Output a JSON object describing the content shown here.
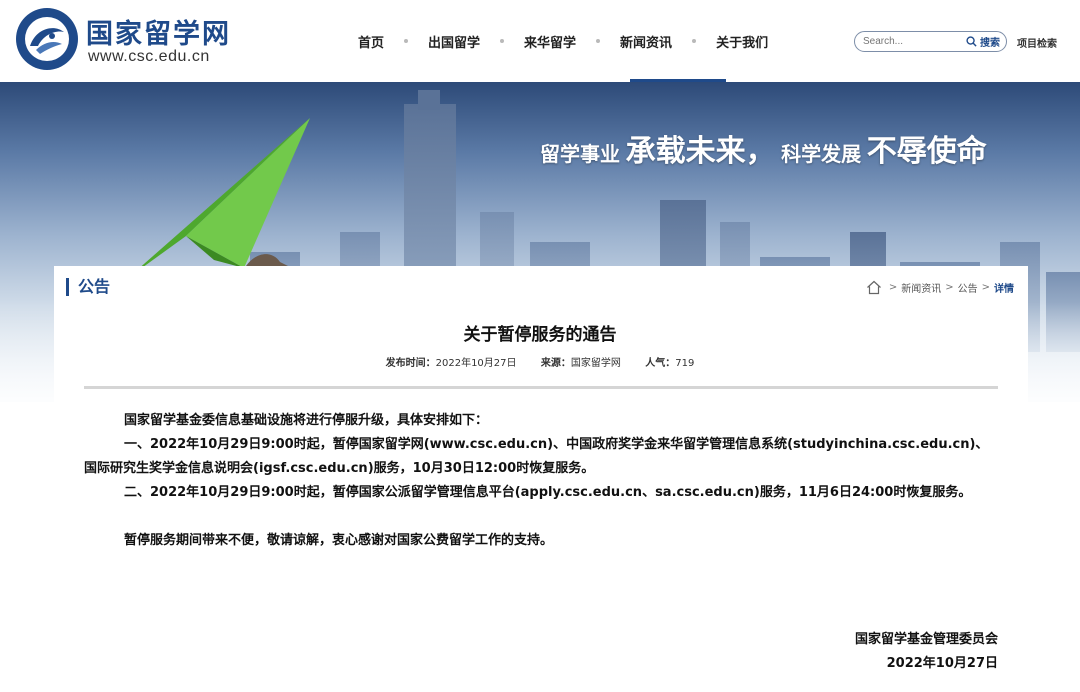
{
  "header": {
    "logo_title": "国家留学网",
    "logo_url": "www.csc.edu.cn",
    "nav": [
      {
        "label": "首页"
      },
      {
        "label": "出国留学"
      },
      {
        "label": "来华留学"
      },
      {
        "label": "新闻资讯"
      },
      {
        "label": "关于我们"
      }
    ],
    "active_nav": "新闻资讯",
    "search": {
      "placeholder": "Search...",
      "button": "搜索"
    },
    "project_search": "项目检索"
  },
  "banner": {
    "slogan_part1": "留学事业",
    "slogan_part2": "承载未来，",
    "slogan_part3": "科学发展",
    "slogan_part4": "不辱使命"
  },
  "section": {
    "label": "公告"
  },
  "breadcrumb": {
    "items": [
      "新闻资讯",
      "公告"
    ],
    "current": "详情",
    "separator": ">"
  },
  "article": {
    "title": "关于暂停服务的通告",
    "meta": {
      "date_label": "发布时间：",
      "date": "2022年10月27日",
      "source_label": "来源：",
      "source": "国家留学网",
      "views_label": "人气：",
      "views": "719"
    },
    "paragraphs": [
      "国家留学基金委信息基础设施将进行停服升级，具体安排如下：",
      "一、2022年10月29日9:00时起，暂停国家留学网(www.csc.edu.cn)、中国政府奖学金来华留学管理信息系统(studyinchina.csc.edu.cn)、国际研究生奖学金信息说明会(igsf.csc.edu.cn)服务，10月30日12:00时恢复服务。",
      "二、2022年10月29日9:00时起，暂停国家公派留学管理信息平台(apply.csc.edu.cn、sa.csc.edu.cn)服务，11月6日24:00时恢复服务。",
      "暂停服务期间带来不便，敬请谅解，衷心感谢对国家公费留学工作的支持。"
    ],
    "signature": {
      "org": "国家留学基金管理委员会",
      "date": "2022年10月27日"
    }
  },
  "colors": {
    "brand": "#1f4a8a",
    "plane": "#5cb83a"
  }
}
